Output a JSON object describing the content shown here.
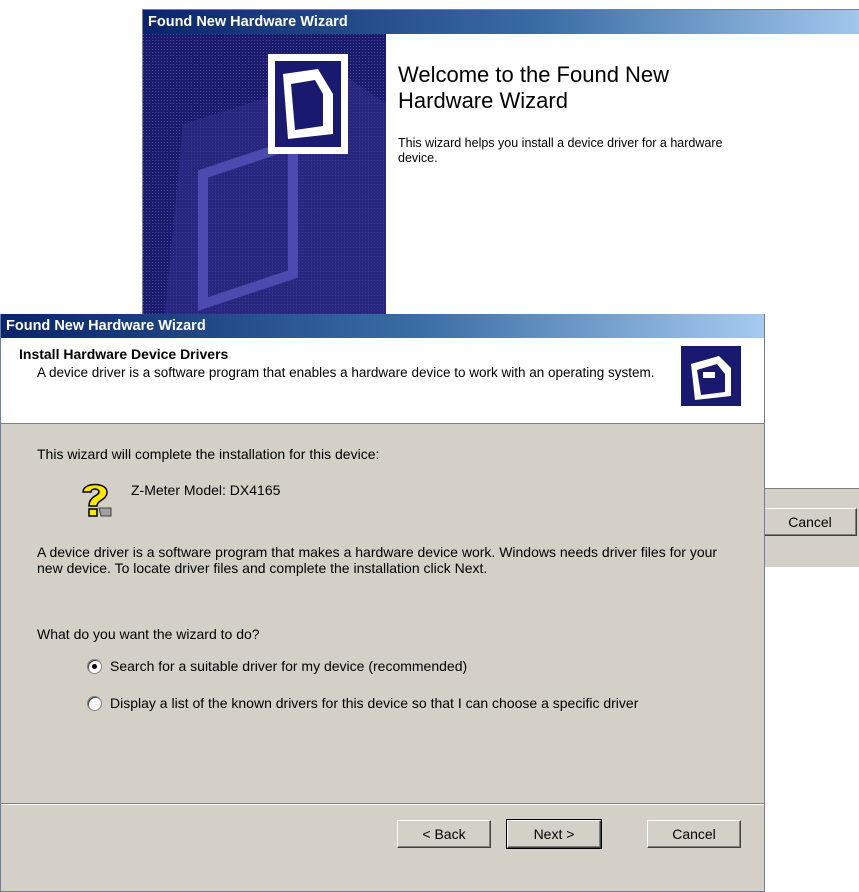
{
  "welcome_window": {
    "title": "Found New Hardware Wizard",
    "heading": "Welcome to the Found New Hardware Wizard",
    "text": "This wizard helps you install a device driver for a hardware device.",
    "cancel_label": "Cancel"
  },
  "install_window": {
    "title": "Found New Hardware Wizard",
    "header": {
      "title": "Install Hardware Device Drivers",
      "subtitle": "A device driver is a software program that enables a hardware device to work with an operating system."
    },
    "intro": "This wizard will complete the installation for this device:",
    "device_name": "Z-Meter Model: DX4165",
    "description": "A device driver is a software program that makes a hardware device work. Windows needs driver files for your new device. To locate driver files and complete the installation click Next.",
    "question": "What do you want the wizard to do?",
    "options": [
      {
        "label": "Search for a suitable driver for my device (recommended)",
        "selected": true
      },
      {
        "label": "Display a list of the known drivers for this device so that I can choose a specific driver",
        "selected": false
      }
    ],
    "buttons": {
      "back": "< Back",
      "next": "Next >",
      "cancel": "Cancel"
    }
  },
  "colors": {
    "titlebar_start": "#0a246a",
    "titlebar_end": "#a6caf0",
    "dialog_face": "#d4d0c8",
    "sidebar_navy": "#191970"
  },
  "icons": {
    "hardware": "hardware-box-icon",
    "unknown_device": "question-mark-icon"
  }
}
